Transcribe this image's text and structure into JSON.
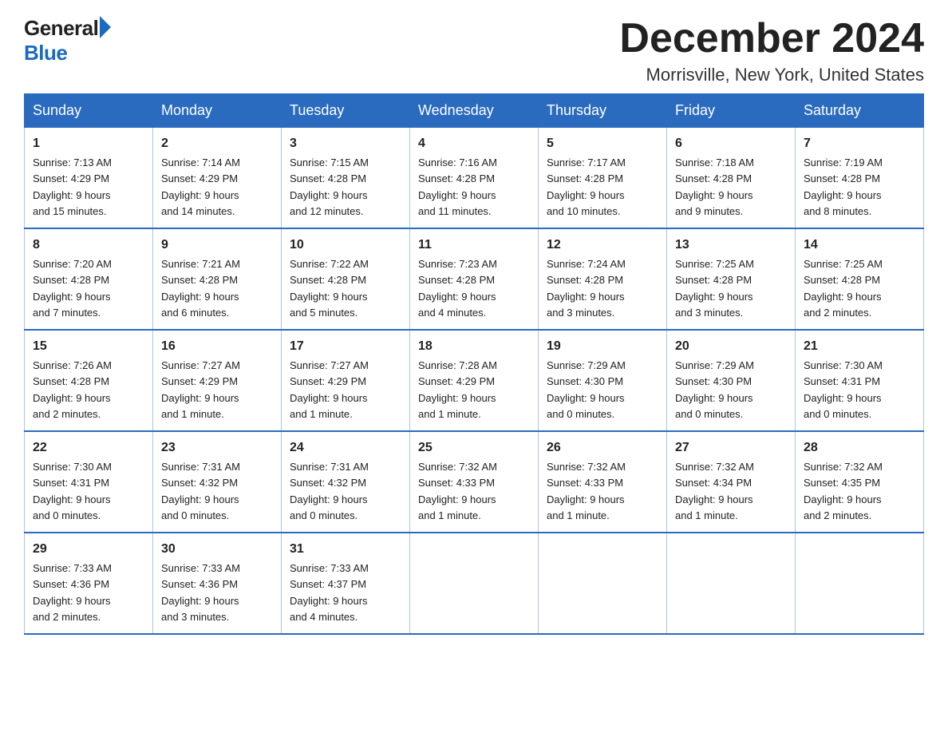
{
  "header": {
    "logo_general": "General",
    "logo_blue": "Blue",
    "month_title": "December 2024",
    "location": "Morrisville, New York, United States"
  },
  "weekdays": [
    "Sunday",
    "Monday",
    "Tuesday",
    "Wednesday",
    "Thursday",
    "Friday",
    "Saturday"
  ],
  "weeks": [
    [
      {
        "day": "1",
        "sunrise": "7:13 AM",
        "sunset": "4:29 PM",
        "daylight": "9 hours and 15 minutes."
      },
      {
        "day": "2",
        "sunrise": "7:14 AM",
        "sunset": "4:29 PM",
        "daylight": "9 hours and 14 minutes."
      },
      {
        "day": "3",
        "sunrise": "7:15 AM",
        "sunset": "4:28 PM",
        "daylight": "9 hours and 12 minutes."
      },
      {
        "day": "4",
        "sunrise": "7:16 AM",
        "sunset": "4:28 PM",
        "daylight": "9 hours and 11 minutes."
      },
      {
        "day": "5",
        "sunrise": "7:17 AM",
        "sunset": "4:28 PM",
        "daylight": "9 hours and 10 minutes."
      },
      {
        "day": "6",
        "sunrise": "7:18 AM",
        "sunset": "4:28 PM",
        "daylight": "9 hours and 9 minutes."
      },
      {
        "day": "7",
        "sunrise": "7:19 AM",
        "sunset": "4:28 PM",
        "daylight": "9 hours and 8 minutes."
      }
    ],
    [
      {
        "day": "8",
        "sunrise": "7:20 AM",
        "sunset": "4:28 PM",
        "daylight": "9 hours and 7 minutes."
      },
      {
        "day": "9",
        "sunrise": "7:21 AM",
        "sunset": "4:28 PM",
        "daylight": "9 hours and 6 minutes."
      },
      {
        "day": "10",
        "sunrise": "7:22 AM",
        "sunset": "4:28 PM",
        "daylight": "9 hours and 5 minutes."
      },
      {
        "day": "11",
        "sunrise": "7:23 AM",
        "sunset": "4:28 PM",
        "daylight": "9 hours and 4 minutes."
      },
      {
        "day": "12",
        "sunrise": "7:24 AM",
        "sunset": "4:28 PM",
        "daylight": "9 hours and 3 minutes."
      },
      {
        "day": "13",
        "sunrise": "7:25 AM",
        "sunset": "4:28 PM",
        "daylight": "9 hours and 3 minutes."
      },
      {
        "day": "14",
        "sunrise": "7:25 AM",
        "sunset": "4:28 PM",
        "daylight": "9 hours and 2 minutes."
      }
    ],
    [
      {
        "day": "15",
        "sunrise": "7:26 AM",
        "sunset": "4:28 PM",
        "daylight": "9 hours and 2 minutes."
      },
      {
        "day": "16",
        "sunrise": "7:27 AM",
        "sunset": "4:29 PM",
        "daylight": "9 hours and 1 minute."
      },
      {
        "day": "17",
        "sunrise": "7:27 AM",
        "sunset": "4:29 PM",
        "daylight": "9 hours and 1 minute."
      },
      {
        "day": "18",
        "sunrise": "7:28 AM",
        "sunset": "4:29 PM",
        "daylight": "9 hours and 1 minute."
      },
      {
        "day": "19",
        "sunrise": "7:29 AM",
        "sunset": "4:30 PM",
        "daylight": "9 hours and 0 minutes."
      },
      {
        "day": "20",
        "sunrise": "7:29 AM",
        "sunset": "4:30 PM",
        "daylight": "9 hours and 0 minutes."
      },
      {
        "day": "21",
        "sunrise": "7:30 AM",
        "sunset": "4:31 PM",
        "daylight": "9 hours and 0 minutes."
      }
    ],
    [
      {
        "day": "22",
        "sunrise": "7:30 AM",
        "sunset": "4:31 PM",
        "daylight": "9 hours and 0 minutes."
      },
      {
        "day": "23",
        "sunrise": "7:31 AM",
        "sunset": "4:32 PM",
        "daylight": "9 hours and 0 minutes."
      },
      {
        "day": "24",
        "sunrise": "7:31 AM",
        "sunset": "4:32 PM",
        "daylight": "9 hours and 0 minutes."
      },
      {
        "day": "25",
        "sunrise": "7:32 AM",
        "sunset": "4:33 PM",
        "daylight": "9 hours and 1 minute."
      },
      {
        "day": "26",
        "sunrise": "7:32 AM",
        "sunset": "4:33 PM",
        "daylight": "9 hours and 1 minute."
      },
      {
        "day": "27",
        "sunrise": "7:32 AM",
        "sunset": "4:34 PM",
        "daylight": "9 hours and 1 minute."
      },
      {
        "day": "28",
        "sunrise": "7:32 AM",
        "sunset": "4:35 PM",
        "daylight": "9 hours and 2 minutes."
      }
    ],
    [
      {
        "day": "29",
        "sunrise": "7:33 AM",
        "sunset": "4:36 PM",
        "daylight": "9 hours and 2 minutes."
      },
      {
        "day": "30",
        "sunrise": "7:33 AM",
        "sunset": "4:36 PM",
        "daylight": "9 hours and 3 minutes."
      },
      {
        "day": "31",
        "sunrise": "7:33 AM",
        "sunset": "4:37 PM",
        "daylight": "9 hours and 4 minutes."
      },
      null,
      null,
      null,
      null
    ]
  ],
  "labels": {
    "sunrise": "Sunrise:",
    "sunset": "Sunset:",
    "daylight": "Daylight:"
  }
}
